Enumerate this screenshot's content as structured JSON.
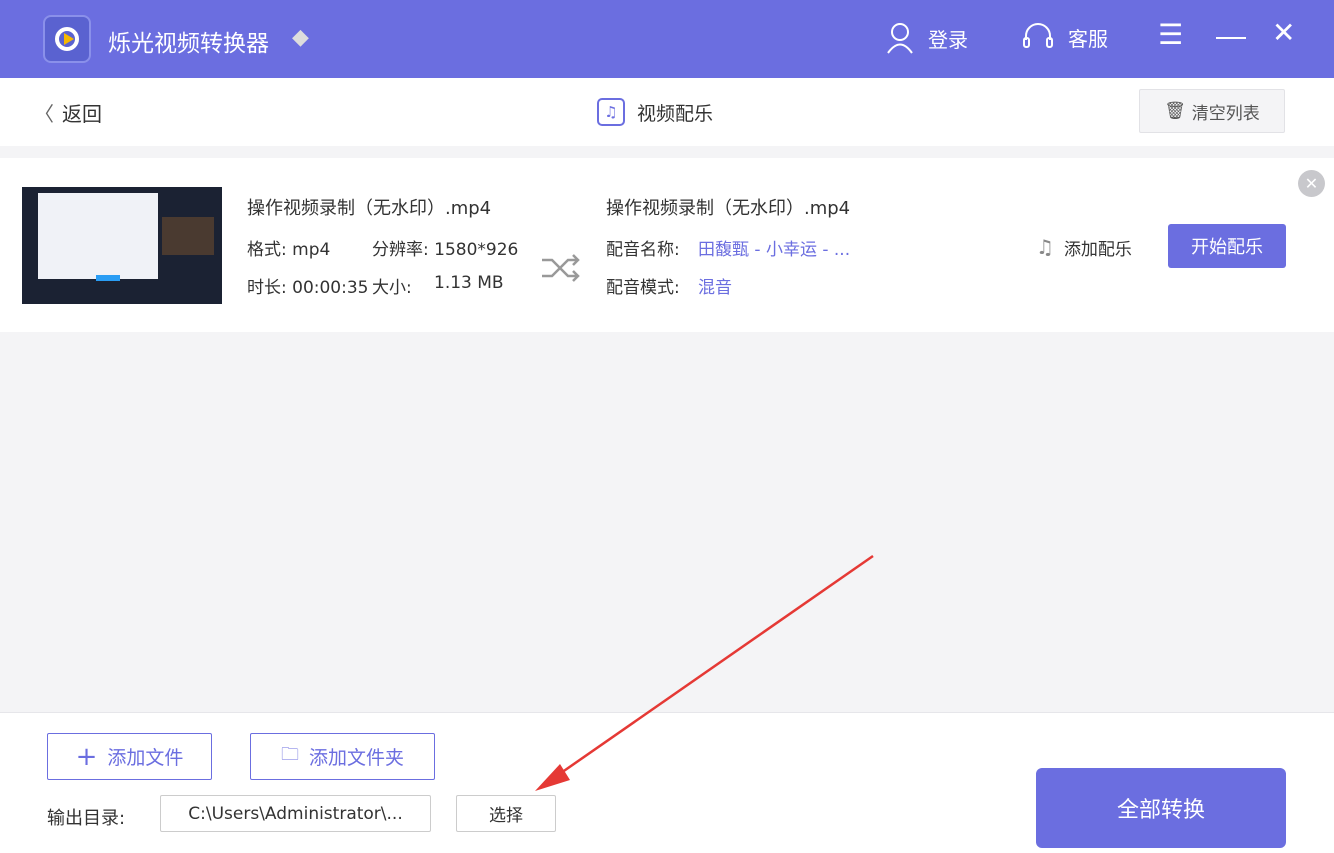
{
  "app": {
    "title": "烁光视频转换器",
    "login": "登录",
    "support": "客服"
  },
  "header": {
    "back": "返回",
    "title": "视频配乐",
    "clear": "清空列表"
  },
  "item": {
    "source_name": "操作视频录制（无水印）.mp4",
    "format_label": "格式: mp4",
    "resolution_label": "分辨率: 1580*926",
    "duration_label": "时长: 00:00:35",
    "size_label": "大小:",
    "size_value": "1.13 MB",
    "output_name": "操作视频录制（无水印）.mp4",
    "music_name_label": "配音名称:",
    "music_name": "田馥甄 - 小幸运 - ...",
    "music_mode_label": "配音模式:",
    "music_mode": "混音",
    "add_music": "添加配乐",
    "start": "开始配乐"
  },
  "bottom": {
    "add_file": "添加文件",
    "add_folder": "添加文件夹",
    "output_label": "输出目录:",
    "output_path": "C:\\Users\\Administrator\\...",
    "choose": "选择",
    "convert_all": "全部转换"
  },
  "colors": {
    "accent": "#6b6ee0",
    "annotation": "#e53935"
  }
}
